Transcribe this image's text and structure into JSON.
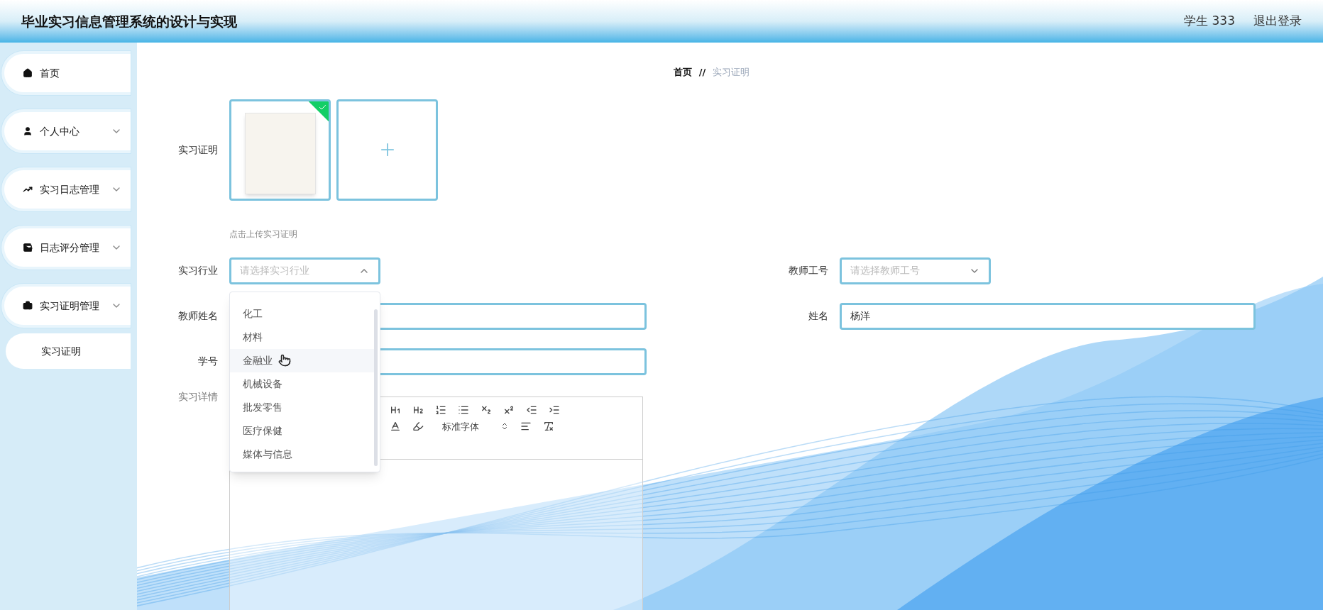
{
  "header": {
    "title": "毕业实习信息管理系统的设计与实现",
    "user": "学生 333",
    "logout": "退出登录"
  },
  "sidebar": {
    "items": [
      {
        "kind": "home",
        "label": "首页",
        "expandable": false
      },
      {
        "kind": "user",
        "label": "个人中心",
        "expandable": true
      },
      {
        "kind": "chart",
        "label": "实习日志管理",
        "expandable": true
      },
      {
        "kind": "wallet",
        "label": "日志评分管理",
        "expandable": true
      },
      {
        "kind": "briefcase",
        "label": "实习证明管理",
        "expandable": true,
        "children": [
          {
            "label": "实习证明"
          }
        ]
      }
    ]
  },
  "breadcrumb": {
    "separator": "//",
    "items": [
      "首页",
      "实习证明"
    ]
  },
  "form": {
    "upload": {
      "label": "实习证明",
      "uploaded": true,
      "hint": "点击上传实习证明"
    },
    "industry": {
      "label": "实习行业",
      "placeholder": "请选择实习行业",
      "open": true,
      "options": [
        {
          "label": "化工",
          "highlighted": false
        },
        {
          "label": "材料",
          "highlighted": false
        },
        {
          "label": "金融业",
          "highlighted": true
        },
        {
          "label": "机械设备",
          "highlighted": false
        },
        {
          "label": "批发零售",
          "highlighted": false
        },
        {
          "label": "医疗保健",
          "highlighted": false
        },
        {
          "label": "媒体与信息",
          "highlighted": false
        }
      ]
    },
    "teacher_id": {
      "label": "教师工号",
      "placeholder": "请选择教师工号",
      "open": false
    },
    "teacher_name": {
      "label": "教师姓名"
    },
    "name": {
      "label": "姓名",
      "value": "杨洋"
    },
    "student_no": {
      "label": "学号"
    },
    "details": {
      "label": "实习详情",
      "font_select": "标准字体"
    }
  }
}
